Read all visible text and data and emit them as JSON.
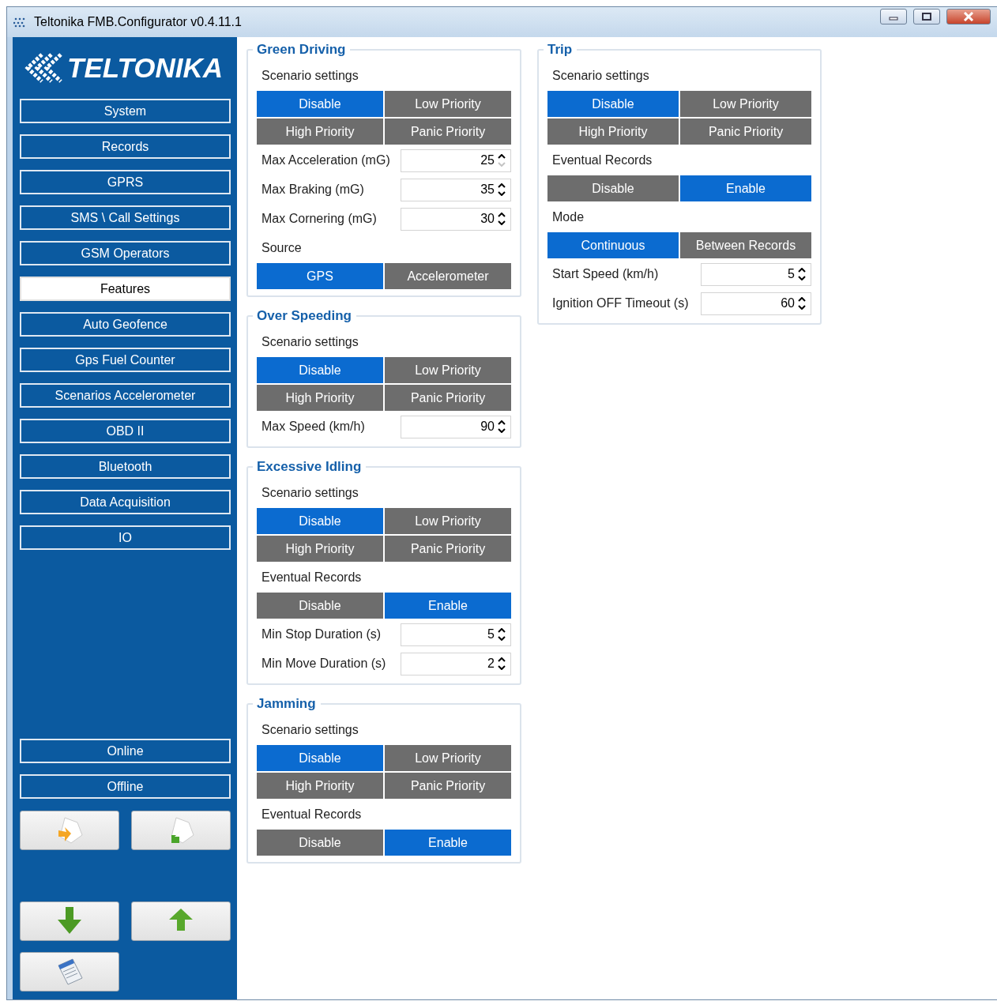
{
  "window": {
    "title": "Teltonika FMB.Configurator v0.4.11.1"
  },
  "sidebar": {
    "logo": "TELTONIKA",
    "items": [
      {
        "label": "System",
        "selected": false
      },
      {
        "label": "Records",
        "selected": false
      },
      {
        "label": "GPRS",
        "selected": false
      },
      {
        "label": "SMS \\ Call Settings",
        "selected": false
      },
      {
        "label": "GSM Operators",
        "selected": false
      },
      {
        "label": "Features",
        "selected": true
      },
      {
        "label": "Auto Geofence",
        "selected": false
      },
      {
        "label": "Gps Fuel Counter",
        "selected": false
      },
      {
        "label": "Scenarios Accelerometer",
        "selected": false
      },
      {
        "label": "OBD II",
        "selected": false
      },
      {
        "label": "Bluetooth",
        "selected": false
      },
      {
        "label": "Data Acquisition",
        "selected": false
      },
      {
        "label": "IO",
        "selected": false
      }
    ],
    "connection": [
      {
        "label": "Online"
      },
      {
        "label": "Offline"
      }
    ]
  },
  "columns": [
    [
      {
        "title": "Green Driving",
        "rows": [
          {
            "kind": "label",
            "text": "Scenario settings"
          },
          {
            "kind": "choice",
            "buttons": [
              {
                "label": "Disable",
                "selected": true
              },
              {
                "label": "Low Priority",
                "selected": false
              },
              {
                "label": "High Priority",
                "selected": false
              },
              {
                "label": "Panic Priority",
                "selected": false
              }
            ]
          },
          {
            "kind": "spinner",
            "label": "Max Acceleration (mG)",
            "value": "25",
            "down_disabled": true
          },
          {
            "kind": "spinner",
            "label": "Max Braking (mG)",
            "value": "35",
            "down_disabled": false
          },
          {
            "kind": "spinner",
            "label": "Max Cornering (mG)",
            "value": "30",
            "down_disabled": false
          },
          {
            "kind": "label",
            "text": "Source"
          },
          {
            "kind": "choice",
            "buttons": [
              {
                "label": "GPS",
                "selected": true
              },
              {
                "label": "Accelerometer",
                "selected": false
              }
            ]
          }
        ]
      },
      {
        "title": "Over Speeding",
        "rows": [
          {
            "kind": "label",
            "text": "Scenario settings"
          },
          {
            "kind": "choice",
            "buttons": [
              {
                "label": "Disable",
                "selected": true
              },
              {
                "label": "Low Priority",
                "selected": false
              },
              {
                "label": "High Priority",
                "selected": false
              },
              {
                "label": "Panic Priority",
                "selected": false
              }
            ]
          },
          {
            "kind": "spinner",
            "label": "Max Speed (km/h)",
            "value": "90",
            "down_disabled": false
          }
        ]
      },
      {
        "title": "Excessive Idling",
        "rows": [
          {
            "kind": "label",
            "text": "Scenario settings"
          },
          {
            "kind": "choice",
            "buttons": [
              {
                "label": "Disable",
                "selected": true
              },
              {
                "label": "Low Priority",
                "selected": false
              },
              {
                "label": "High Priority",
                "selected": false
              },
              {
                "label": "Panic Priority",
                "selected": false
              }
            ]
          },
          {
            "kind": "label",
            "text": "Eventual Records"
          },
          {
            "kind": "choice",
            "buttons": [
              {
                "label": "Disable",
                "selected": false
              },
              {
                "label": "Enable",
                "selected": true
              }
            ]
          },
          {
            "kind": "spinner",
            "label": "Min Stop Duration (s)",
            "value": "5",
            "down_disabled": false
          },
          {
            "kind": "spinner",
            "label": "Min Move Duration (s)",
            "value": "2",
            "down_disabled": false
          }
        ]
      },
      {
        "title": "Jamming",
        "rows": [
          {
            "kind": "label",
            "text": "Scenario settings"
          },
          {
            "kind": "choice",
            "buttons": [
              {
                "label": "Disable",
                "selected": true
              },
              {
                "label": "Low Priority",
                "selected": false
              },
              {
                "label": "High Priority",
                "selected": false
              },
              {
                "label": "Panic Priority",
                "selected": false
              }
            ]
          },
          {
            "kind": "label",
            "text": "Eventual Records"
          },
          {
            "kind": "choice",
            "buttons": [
              {
                "label": "Disable",
                "selected": false
              },
              {
                "label": "Enable",
                "selected": true
              }
            ]
          }
        ]
      }
    ],
    [
      {
        "title": "Trip",
        "rows": [
          {
            "kind": "label",
            "text": "Scenario settings"
          },
          {
            "kind": "choice",
            "buttons": [
              {
                "label": "Disable",
                "selected": true
              },
              {
                "label": "Low Priority",
                "selected": false
              },
              {
                "label": "High Priority",
                "selected": false
              },
              {
                "label": "Panic Priority",
                "selected": false
              }
            ]
          },
          {
            "kind": "label",
            "text": "Eventual Records"
          },
          {
            "kind": "choice",
            "buttons": [
              {
                "label": "Disable",
                "selected": false
              },
              {
                "label": "Enable",
                "selected": true
              }
            ]
          },
          {
            "kind": "label",
            "text": "Mode"
          },
          {
            "kind": "choice",
            "buttons": [
              {
                "label": "Continuous",
                "selected": true
              },
              {
                "label": "Between Records",
                "selected": false
              }
            ]
          },
          {
            "kind": "spinner",
            "label": "Start Speed (km/h)",
            "value": "5",
            "down_disabled": false
          },
          {
            "kind": "spinner",
            "label": "Ignition OFF Timeout (s)",
            "value": "60",
            "down_disabled": false
          }
        ]
      }
    ]
  ]
}
